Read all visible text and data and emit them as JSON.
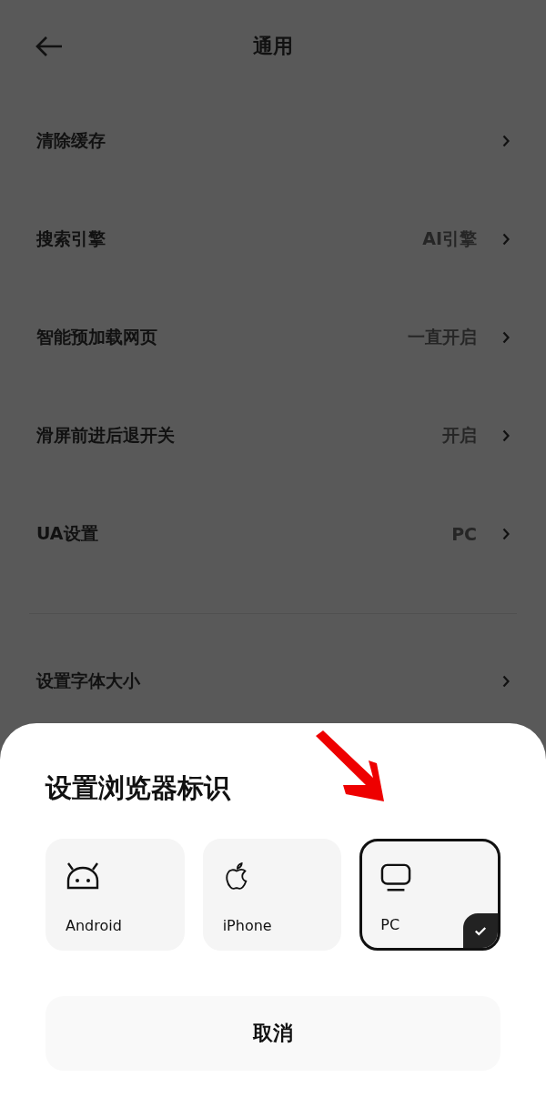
{
  "header": {
    "title": "通用"
  },
  "settings": [
    {
      "label": "清除缓存"
    },
    {
      "label": "搜索引擎",
      "value": "AI引擎"
    },
    {
      "label": "智能预加载网页",
      "value": "一直开启"
    },
    {
      "label": "滑屏前进后退开关",
      "value": "开启"
    },
    {
      "label": "UA设置",
      "value": "PC"
    }
  ],
  "settings_2": [
    {
      "label": "设置字体大小"
    }
  ],
  "sheet": {
    "title": "设置浏览器标识",
    "options": [
      {
        "kind": "android",
        "label": "Android",
        "selected": false
      },
      {
        "kind": "apple",
        "label": "iPhone",
        "selected": false
      },
      {
        "kind": "monitor",
        "label": "PC",
        "selected": true
      }
    ],
    "cancel": "取消"
  }
}
